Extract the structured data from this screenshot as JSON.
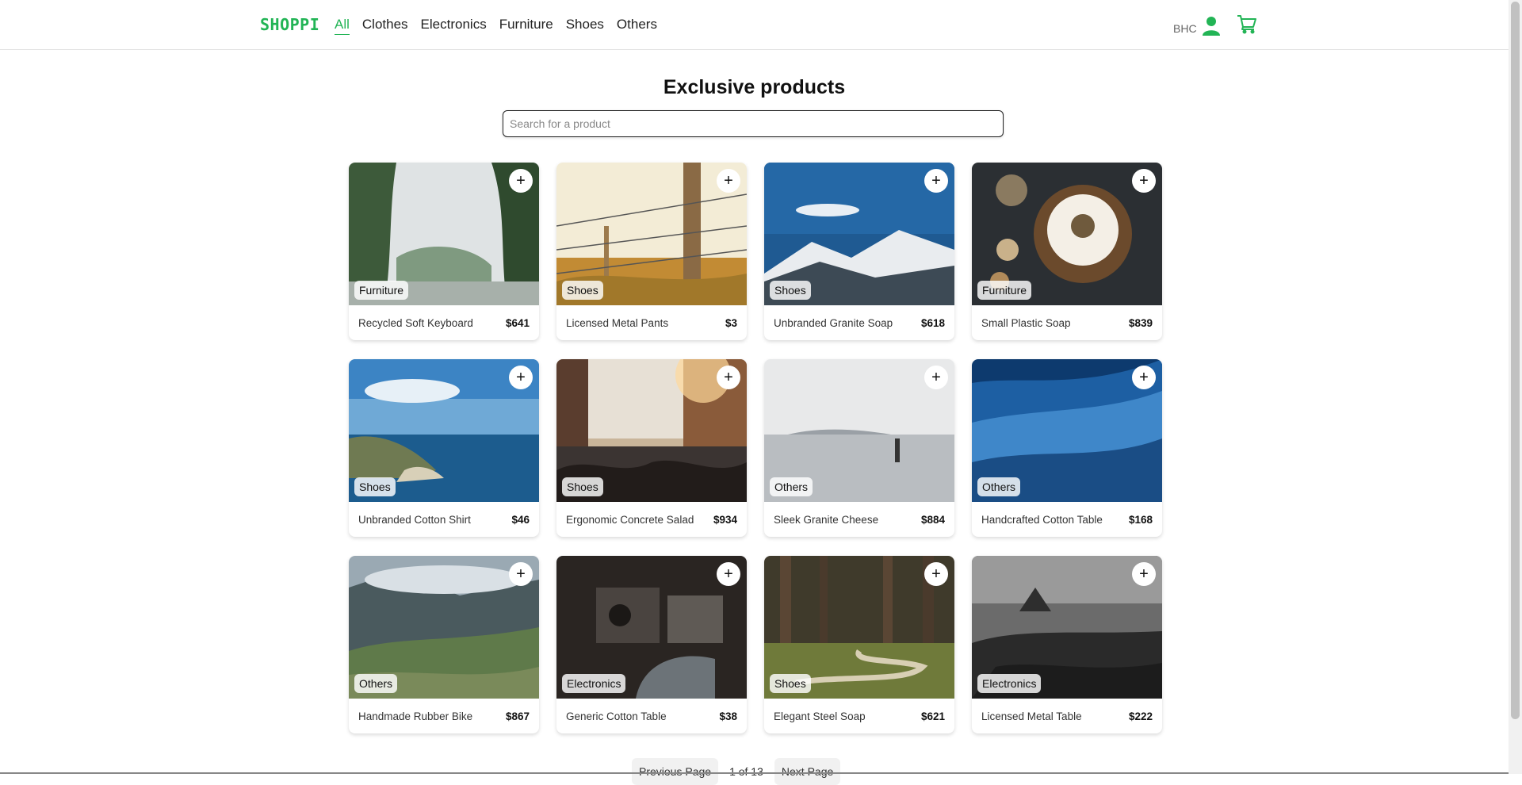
{
  "nav": {
    "logo": "SHOPPI",
    "categories": [
      {
        "label": "All",
        "active": true
      },
      {
        "label": "Clothes",
        "active": false
      },
      {
        "label": "Electronics",
        "active": false
      },
      {
        "label": "Furniture",
        "active": false
      },
      {
        "label": "Shoes",
        "active": false
      },
      {
        "label": "Others",
        "active": false
      }
    ],
    "user_label": "BHC",
    "accent": "#22b455"
  },
  "main": {
    "title": "Exclusive products",
    "search_placeholder": "Search for a product"
  },
  "products": [
    {
      "name": "Recycled Soft Keyboard",
      "price": "$641",
      "category": "Furniture",
      "scene": "misty-trees"
    },
    {
      "name": "Licensed Metal Pants",
      "price": "$3",
      "category": "Shoes",
      "scene": "fence"
    },
    {
      "name": "Unbranded Granite Soap",
      "price": "$618",
      "category": "Shoes",
      "scene": "snow-mountain"
    },
    {
      "name": "Small Plastic Soap",
      "price": "$839",
      "category": "Furniture",
      "scene": "dark-food"
    },
    {
      "name": "Unbranded Cotton Shirt",
      "price": "$46",
      "category": "Shoes",
      "scene": "coast"
    },
    {
      "name": "Ergonomic Concrete Salad",
      "price": "$934",
      "category": "Shoes",
      "scene": "city-crowd"
    },
    {
      "name": "Sleek Granite Cheese",
      "price": "$884",
      "category": "Others",
      "scene": "foggy-sea"
    },
    {
      "name": "Handcrafted Cotton Table",
      "price": "$168",
      "category": "Others",
      "scene": "wave"
    },
    {
      "name": "Handmade Rubber Bike",
      "price": "$867",
      "category": "Others",
      "scene": "green-mountain"
    },
    {
      "name": "Generic Cotton Table",
      "price": "$38",
      "category": "Electronics",
      "scene": "machine"
    },
    {
      "name": "Elegant Steel Soap",
      "price": "$621",
      "category": "Shoes",
      "scene": "forest-path"
    },
    {
      "name": "Licensed Metal Table",
      "price": "$222",
      "category": "Electronics",
      "scene": "rocky-coast"
    }
  ],
  "pager": {
    "prev": "Previous Page",
    "info": "1 of 13",
    "next": "Next Page"
  }
}
